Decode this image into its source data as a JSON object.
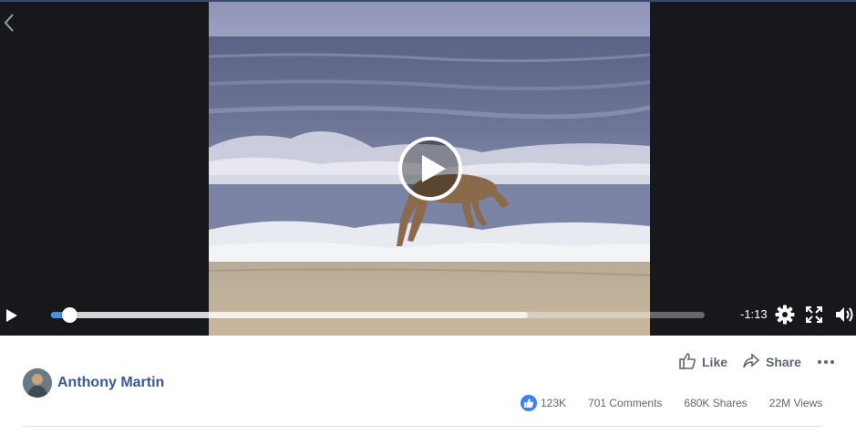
{
  "video": {
    "time_remaining": "-1:13",
    "progress_played": 0.02,
    "progress_buffered": 0.73
  },
  "actions": {
    "like_label": "Like",
    "share_label": "Share"
  },
  "post": {
    "author_name": "Anthony Martin"
  },
  "stats": {
    "reaction_count": "123K",
    "comments": "701 Comments",
    "shares": "680K Shares",
    "views": "22M Views"
  },
  "colors": {
    "progress_played": "#4a90e2",
    "author_link": "#385898",
    "like_badge": "#3b82f6"
  },
  "icons": [
    "back-arrow-icon",
    "play-icon",
    "settings-icon",
    "fullscreen-icon",
    "volume-icon",
    "thumbs-up-icon",
    "share-arrow-icon",
    "more-icon"
  ]
}
